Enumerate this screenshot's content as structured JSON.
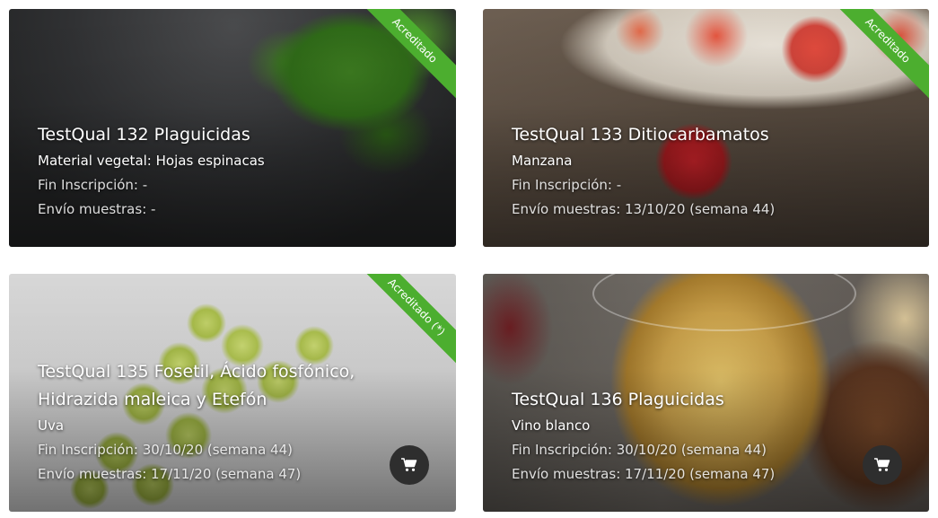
{
  "cards": [
    {
      "title": "TestQual 132 Plaguicidas",
      "subtitle": "Material vegetal: Hojas espinacas",
      "deadline": "Fin Inscripción: -",
      "shipping": "Envío muestras: -",
      "badge": "Acreditado",
      "badge_color": "#4cae2f",
      "image": "spinach-leaves-on-slate",
      "has_cart": false
    },
    {
      "title": "TestQual 133 Ditiocarbamatos",
      "subtitle": "Manzana",
      "deadline": "Fin Inscripción: -",
      "shipping": "Envío muestras: 13/10/20 (semana 44)",
      "badge": "Acreditado",
      "badge_color": "#4cae2f",
      "image": "apples-on-wooden-table",
      "has_cart": false
    },
    {
      "title": "TestQual 135 Fosetil, Ácido fosfónico, Hidrazida maleica y Etefón",
      "subtitle": "Uva",
      "deadline": "Fin Inscripción: 30/10/20 (semana 44)",
      "shipping": "Envío muestras: 17/11/20 (semana 47)",
      "badge": "Acreditado (*)",
      "badge_color": "#4cae2f",
      "image": "green-grapes",
      "has_cart": true,
      "cart_icon": "shopping-cart-icon"
    },
    {
      "title": "TestQual 136 Plaguicidas",
      "subtitle": "Vino blanco",
      "deadline": "Fin Inscripción: 30/10/20 (semana 44)",
      "shipping": "Envío muestras: 17/11/20 (semana 47)",
      "badge": "",
      "image": "white-wine-glass",
      "has_cart": true,
      "cart_icon": "shopping-cart-icon"
    }
  ]
}
